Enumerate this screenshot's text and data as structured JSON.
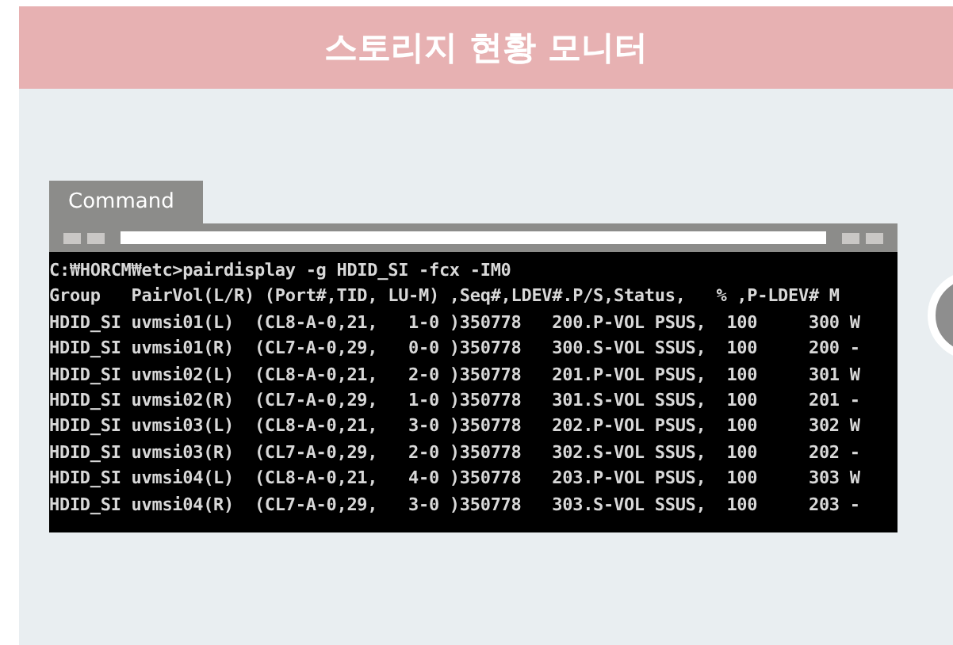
{
  "header": {
    "title": "스토리지 현황 모니터"
  },
  "command_window": {
    "tab": "Command",
    "lines": [
      "C:₩HORCM₩etc>pairdisplay -g HDID_SI -fcx -IM0",
      "Group   PairVol(L/R) (Port#,TID, LU-M) ,Seq#,LDEV#.P/S,Status,   % ,P-LDEV# M",
      "HDID_SI uvmsi01(L)  (CL8-A-0,21,   1-0 )350778   200.P-VOL PSUS,  100     300 W",
      "HDID_SI uvmsi01(R)  (CL7-A-0,29,   0-0 )350778   300.S-VOL SSUS,  100     200 -",
      "HDID_SI uvmsi02(L)  (CL8-A-0,21,   2-0 )350778   201.P-VOL PSUS,  100     301 W",
      "HDID_SI uvmsi02(R)  (CL7-A-0,29,   1-0 )350778   301.S-VOL SSUS,  100     201 -",
      "HDID_SI uvmsi03(L)  (CL8-A-0,21,   3-0 )350778   202.P-VOL PSUS,  100     302 W",
      "HDID_SI uvmsi03(R)  (CL7-A-0,29,   2-0 )350778   302.S-VOL SSUS,  100     202 -",
      "HDID_SI uvmsi04(L)  (CL8-A-0,21,   4-0 )350778   203.P-VOL PSUS,  100     303 W",
      "HDID_SI uvmsi04(R)  (CL7-A-0,29,   3-0 )350778   303.S-VOL SSUS,  100     203 -"
    ]
  }
}
